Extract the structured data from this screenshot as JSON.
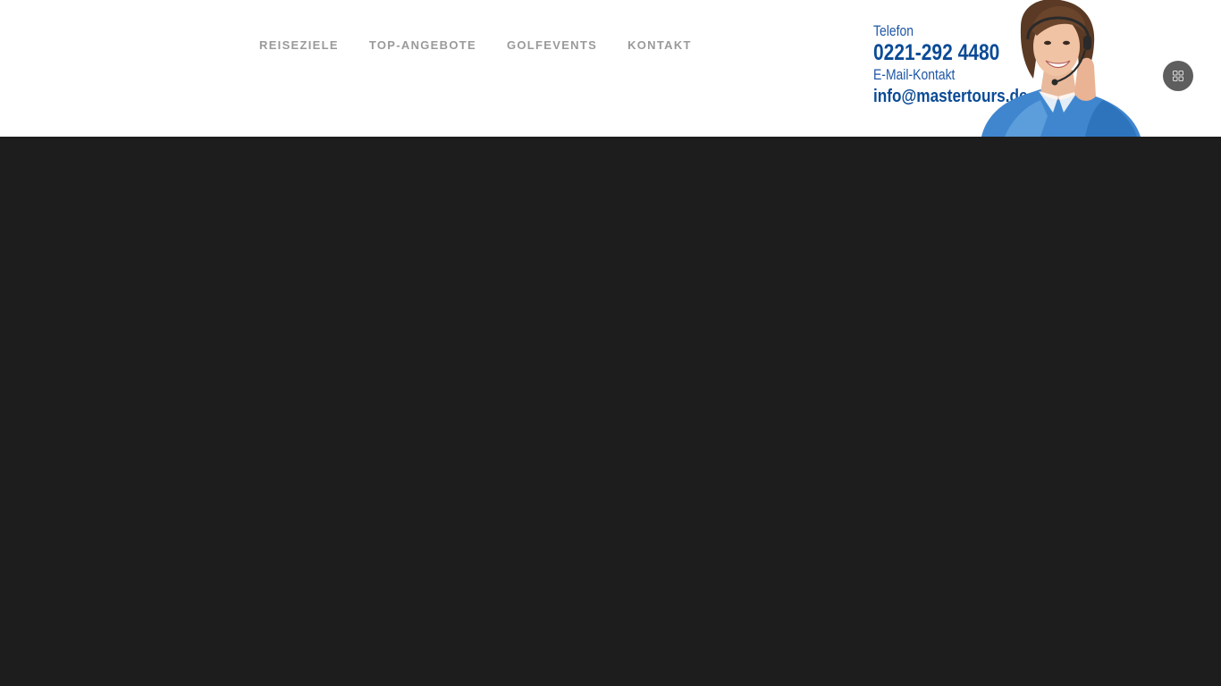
{
  "nav": {
    "items": [
      {
        "label": "REISEZIELE"
      },
      {
        "label": "TOP-ANGEBOTE"
      },
      {
        "label": "GOLFEVENTS"
      },
      {
        "label": "KONTAKT"
      }
    ]
  },
  "contact": {
    "phone_label": "Telefon",
    "phone_number": "0221-292 4480",
    "email_label": "E-Mail-Kontakt",
    "email": "info@mastertours.de"
  },
  "icons": {
    "menu": "grid-icon",
    "agent": "support-agent-photo"
  },
  "colors": {
    "header_bg": "#ffffff",
    "nav_text": "#9a9a9a",
    "contact_text": "#0b4b96",
    "page_bg": "#1d1d1d",
    "menu_button": "#5e5e5e"
  }
}
